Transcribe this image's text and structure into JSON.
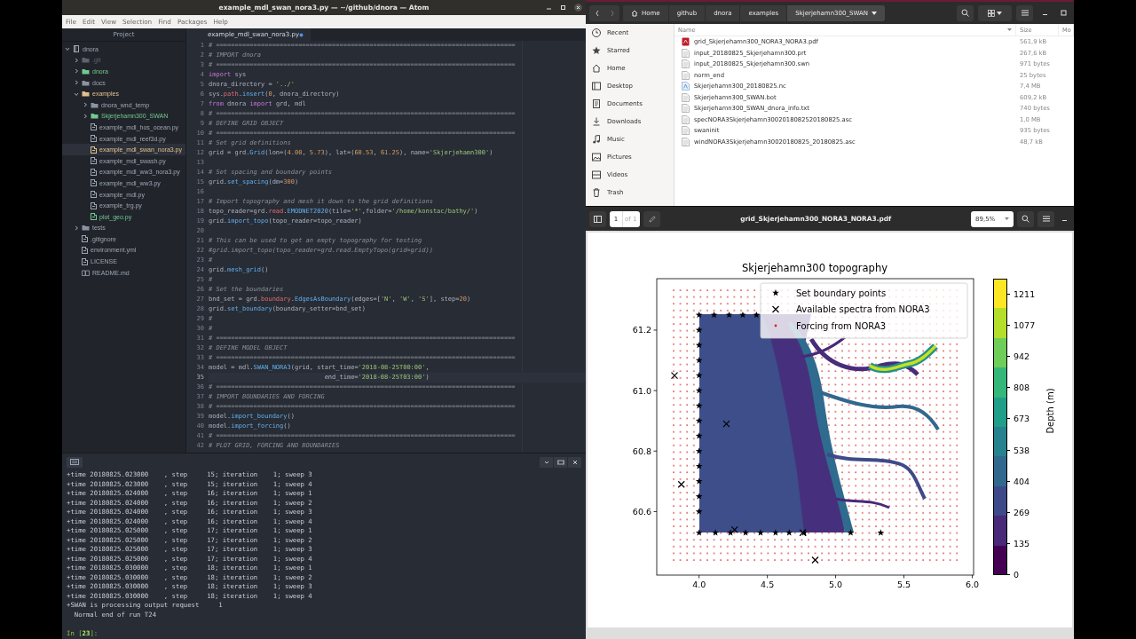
{
  "atom": {
    "title": "example_mdl_swan_nora3.py — ~/github/dnora — Atom",
    "menu": [
      "File",
      "Edit",
      "View",
      "Selection",
      "Find",
      "Packages",
      "Help"
    ],
    "project_title": "Project",
    "tree": [
      {
        "label": "dnora",
        "kind": "repo",
        "expanded": true,
        "selected": false,
        "children": [
          {
            "label": ".git",
            "kind": "folder",
            "expanded": false,
            "selected": false,
            "color": "#5c6370"
          },
          {
            "label": "dnora",
            "kind": "folder",
            "expanded": false,
            "selected": false,
            "color": "#73c990"
          },
          {
            "label": "docs",
            "kind": "folder",
            "expanded": false,
            "selected": false
          },
          {
            "label": "examples",
            "kind": "folder",
            "expanded": true,
            "selected": false,
            "color": "#e2c08d",
            "children": [
              {
                "label": "dnora_wnd_temp",
                "kind": "folder",
                "expanded": false,
                "selected": false
              },
              {
                "label": "Skjerjehamn300_SWAN",
                "kind": "folder",
                "expanded": false,
                "selected": false,
                "color": "#73c990"
              },
              {
                "label": "example_mdl_hos_ocean.py",
                "kind": "file",
                "selected": false
              },
              {
                "label": "example_mdl_reef3d.py",
                "kind": "file",
                "selected": false
              },
              {
                "label": "example_mdl_swan_nora3.py",
                "kind": "file",
                "selected": true,
                "color": "#e2c08d"
              },
              {
                "label": "example_mdl_swash.py",
                "kind": "file",
                "selected": false
              },
              {
                "label": "example_mdl_ww3_nora3.py",
                "kind": "file",
                "selected": false
              },
              {
                "label": "example_mdl_ww3.py",
                "kind": "file",
                "selected": false
              },
              {
                "label": "example_mdl.py",
                "kind": "file",
                "selected": false
              },
              {
                "label": "example_trg.py",
                "kind": "file",
                "selected": false
              },
              {
                "label": "plot_geo.py",
                "kind": "file",
                "selected": false,
                "color": "#73c990"
              }
            ]
          },
          {
            "label": "tests",
            "kind": "folder",
            "expanded": false,
            "selected": false
          },
          {
            "label": ".gitignore",
            "kind": "file",
            "selected": false
          },
          {
            "label": "environment.yml",
            "kind": "file",
            "selected": false
          },
          {
            "label": "LICENSE",
            "kind": "file",
            "selected": false
          },
          {
            "label": "README.md",
            "kind": "markdown",
            "selected": false
          }
        ]
      }
    ],
    "tab": {
      "label": "example_mdl_swan_nora3.py",
      "selected": true,
      "modified": true
    },
    "code": [
      {
        "number": "1",
        "current": false,
        "tokens": [
          {
            "kind": "com",
            "text": "# ================================================================================"
          }
        ]
      },
      {
        "number": "2",
        "current": false,
        "tokens": [
          {
            "kind": "com",
            "text": "# IMPORT dnora"
          }
        ]
      },
      {
        "number": "3",
        "current": false,
        "tokens": [
          {
            "kind": "com",
            "text": "# ================================================================================"
          }
        ]
      },
      {
        "number": "4",
        "current": false,
        "tokens": [
          {
            "kind": "kw",
            "text": "import"
          },
          {
            "kind": "txt",
            "text": " sys"
          }
        ]
      },
      {
        "number": "5",
        "current": false,
        "tokens": [
          {
            "kind": "txt",
            "text": "dnora_directory = "
          },
          {
            "kind": "str",
            "text": "'../'"
          }
        ]
      },
      {
        "number": "6",
        "current": false,
        "tokens": [
          {
            "kind": "txt",
            "text": "sys."
          },
          {
            "kind": "attr",
            "text": "path"
          },
          {
            "kind": "txt",
            "text": "."
          },
          {
            "kind": "fn",
            "text": "insert"
          },
          {
            "kind": "txt",
            "text": "("
          },
          {
            "kind": "num",
            "text": "0"
          },
          {
            "kind": "txt",
            "text": ", dnora_directory)"
          }
        ]
      },
      {
        "number": "7",
        "current": false,
        "tokens": [
          {
            "kind": "kw",
            "text": "from"
          },
          {
            "kind": "txt",
            "text": " dnora "
          },
          {
            "kind": "kw",
            "text": "import"
          },
          {
            "kind": "txt",
            "text": " grd, mdl"
          }
        ]
      },
      {
        "number": "8",
        "current": false,
        "tokens": [
          {
            "kind": "com",
            "text": "# ================================================================================"
          }
        ]
      },
      {
        "number": "9",
        "current": false,
        "tokens": [
          {
            "kind": "com",
            "text": "# DEFINE GRID OBJECT"
          }
        ]
      },
      {
        "number": "10",
        "current": false,
        "tokens": [
          {
            "kind": "com",
            "text": "# ================================================================================"
          }
        ]
      },
      {
        "number": "11",
        "current": false,
        "tokens": [
          {
            "kind": "com",
            "text": "# Set grid definitions"
          }
        ]
      },
      {
        "number": "12",
        "current": false,
        "tokens": [
          {
            "kind": "txt",
            "text": "grid = grd."
          },
          {
            "kind": "fn",
            "text": "Grid"
          },
          {
            "kind": "txt",
            "text": "(lon=("
          },
          {
            "kind": "num",
            "text": "4.00"
          },
          {
            "kind": "txt",
            "text": ", "
          },
          {
            "kind": "num",
            "text": "5.73"
          },
          {
            "kind": "txt",
            "text": "), lat=("
          },
          {
            "kind": "num",
            "text": "60.53"
          },
          {
            "kind": "txt",
            "text": ", "
          },
          {
            "kind": "num",
            "text": "61.25"
          },
          {
            "kind": "txt",
            "text": "), name="
          },
          {
            "kind": "str",
            "text": "'Skjerjehamn300'"
          },
          {
            "kind": "txt",
            "text": ")"
          }
        ]
      },
      {
        "number": "13",
        "current": false
      },
      {
        "number": "14",
        "current": false,
        "tokens": [
          {
            "kind": "com",
            "text": "# Set spacing and boundary points"
          }
        ]
      },
      {
        "number": "15",
        "current": false,
        "tokens": [
          {
            "kind": "txt",
            "text": "grid."
          },
          {
            "kind": "fn",
            "text": "set_spacing"
          },
          {
            "kind": "txt",
            "text": "(dm="
          },
          {
            "kind": "num",
            "text": "300"
          },
          {
            "kind": "txt",
            "text": ")"
          }
        ]
      },
      {
        "number": "16",
        "current": false
      },
      {
        "number": "17",
        "current": false,
        "tokens": [
          {
            "kind": "com",
            "text": "# Import topography and mesh it down to the grid definitions"
          }
        ]
      },
      {
        "number": "18",
        "current": false,
        "tokens": [
          {
            "kind": "txt",
            "text": "topo_reader=grd."
          },
          {
            "kind": "attr",
            "text": "read"
          },
          {
            "kind": "txt",
            "text": "."
          },
          {
            "kind": "fn",
            "text": "EMODNET2020"
          },
          {
            "kind": "txt",
            "text": "(tile="
          },
          {
            "kind": "str",
            "text": "'*'"
          },
          {
            "kind": "txt",
            "text": ",folder="
          },
          {
            "kind": "str",
            "text": "'/home/konstac/bathy/'"
          },
          {
            "kind": "txt",
            "text": ")"
          }
        ]
      },
      {
        "number": "19",
        "current": false,
        "tokens": [
          {
            "kind": "txt",
            "text": "grid."
          },
          {
            "kind": "fn",
            "text": "import_topo"
          },
          {
            "kind": "txt",
            "text": "(topo_reader=topo_reader)"
          }
        ]
      },
      {
        "number": "20",
        "current": false
      },
      {
        "number": "21",
        "current": false,
        "tokens": [
          {
            "kind": "com",
            "text": "# This can be used to get an empty topography for testing"
          }
        ]
      },
      {
        "number": "22",
        "current": false,
        "tokens": [
          {
            "kind": "com",
            "text": "#grid.import_topo(topo_reader=grd.read.EmptyTopo(grid=grid))"
          }
        ]
      },
      {
        "number": "23",
        "current": false,
        "tokens": [
          {
            "kind": "com",
            "text": "#"
          }
        ]
      },
      {
        "number": "24",
        "current": false,
        "tokens": [
          {
            "kind": "txt",
            "text": "grid."
          },
          {
            "kind": "fn",
            "text": "mesh_grid"
          },
          {
            "kind": "txt",
            "text": "()"
          }
        ]
      },
      {
        "number": "25",
        "current": false,
        "tokens": [
          {
            "kind": "com",
            "text": "#"
          }
        ]
      },
      {
        "number": "26",
        "current": false,
        "tokens": [
          {
            "kind": "com",
            "text": "# Set the boundaries"
          }
        ]
      },
      {
        "number": "27",
        "current": false,
        "tokens": [
          {
            "kind": "txt",
            "text": "bnd_set = grd."
          },
          {
            "kind": "attr",
            "text": "boundary"
          },
          {
            "kind": "txt",
            "text": "."
          },
          {
            "kind": "fn",
            "text": "EdgesAsBoundary"
          },
          {
            "kind": "txt",
            "text": "(edges=["
          },
          {
            "kind": "str",
            "text": "'N'"
          },
          {
            "kind": "txt",
            "text": ", "
          },
          {
            "kind": "str",
            "text": "'W'"
          },
          {
            "kind": "txt",
            "text": ", "
          },
          {
            "kind": "str",
            "text": "'S'"
          },
          {
            "kind": "txt",
            "text": "], step="
          },
          {
            "kind": "num",
            "text": "20"
          },
          {
            "kind": "txt",
            "text": ")"
          }
        ]
      },
      {
        "number": "28",
        "current": false,
        "tokens": [
          {
            "kind": "txt",
            "text": "grid."
          },
          {
            "kind": "fn",
            "text": "set_boundary"
          },
          {
            "kind": "txt",
            "text": "(boundary_setter=bnd_set)"
          }
        ]
      },
      {
        "number": "29",
        "current": false,
        "tokens": [
          {
            "kind": "com",
            "text": "#"
          }
        ]
      },
      {
        "number": "30",
        "current": false,
        "tokens": [
          {
            "kind": "com",
            "text": "#"
          }
        ]
      },
      {
        "number": "31",
        "current": false,
        "tokens": [
          {
            "kind": "com",
            "text": "# ================================================================================"
          }
        ]
      },
      {
        "number": "32",
        "current": false,
        "tokens": [
          {
            "kind": "com",
            "text": "# DEFINE MODEL OBJECT"
          }
        ]
      },
      {
        "number": "33",
        "current": false,
        "tokens": [
          {
            "kind": "com",
            "text": "# ================================================================================"
          }
        ]
      },
      {
        "number": "34",
        "current": false,
        "tokens": [
          {
            "kind": "txt",
            "text": "model = mdl."
          },
          {
            "kind": "fn",
            "text": "SWAN_NORA3"
          },
          {
            "kind": "txt",
            "text": "(grid, start_time="
          },
          {
            "kind": "str",
            "text": "'2018-08-25T00:00'"
          },
          {
            "kind": "txt",
            "text": ","
          }
        ]
      },
      {
        "number": "35",
        "current": true,
        "tokens": [
          {
            "kind": "txt",
            "text": "                               end_time="
          },
          {
            "kind": "str",
            "text": "'2018-08-25T03:00'"
          },
          {
            "kind": "txt",
            "text": ")"
          }
        ]
      },
      {
        "number": "36",
        "current": false,
        "tokens": [
          {
            "kind": "com",
            "text": "# ================================================================================"
          }
        ]
      },
      {
        "number": "37",
        "current": false,
        "tokens": [
          {
            "kind": "com",
            "text": "# IMPORT BOUNDARIES AND FORCING"
          }
        ]
      },
      {
        "number": "38",
        "current": false,
        "tokens": [
          {
            "kind": "com",
            "text": "# ================================================================================"
          }
        ]
      },
      {
        "number": "39",
        "current": false,
        "tokens": [
          {
            "kind": "txt",
            "text": "model."
          },
          {
            "kind": "fn",
            "text": "import_boundary"
          },
          {
            "kind": "txt",
            "text": "()"
          }
        ]
      },
      {
        "number": "40",
        "current": false,
        "tokens": [
          {
            "kind": "txt",
            "text": "model."
          },
          {
            "kind": "fn",
            "text": "import_forcing"
          },
          {
            "kind": "txt",
            "text": "()"
          }
        ]
      },
      {
        "number": "41",
        "current": false,
        "tokens": [
          {
            "kind": "com",
            "text": "# ================================================================================"
          }
        ]
      },
      {
        "number": "42",
        "current": false,
        "tokens": [
          {
            "kind": "com",
            "text": "# PLOT GRID, FORCING AND BOUNDARIES"
          }
        ]
      }
    ],
    "terminal": {
      "lines": [
        "+time 20180825.023000    , step     15; iteration    1; sweep 3",
        "+time 20180825.023000    , step     15; iteration    1; sweep 4",
        "+time 20180825.024000    , step     16; iteration    1; sweep 1",
        "+time 20180825.024000    , step     16; iteration    1; sweep 2",
        "+time 20180825.024000    , step     16; iteration    1; sweep 3",
        "+time 20180825.024000    , step     16; iteration    1; sweep 4",
        "+time 20180825.025000    , step     17; iteration    1; sweep 1",
        "+time 20180825.025000    , step     17; iteration    1; sweep 2",
        "+time 20180825.025000    , step     17; iteration    1; sweep 3",
        "+time 20180825.025000    , step     17; iteration    1; sweep 4",
        "+time 20180825.030000    , step     18; iteration    1; sweep 1",
        "+time 20180825.030000    , step     18; iteration    1; sweep 2",
        "+time 20180825.030000    , step     18; iteration    1; sweep 3",
        "+time 20180825.030000    , step     18; iteration    1; sweep 4",
        "+SWAN is processing output request     1",
        "  Normal end of run T24"
      ],
      "prompt": "In [**23**]:"
    }
  },
  "files": {
    "path": [
      {
        "label": "Home",
        "kind": "home",
        "selected": false
      },
      {
        "label": "github",
        "selected": false
      },
      {
        "label": "dnora",
        "selected": false
      },
      {
        "label": "examples",
        "selected": false
      },
      {
        "label": "Skjerjehamn300_SWAN",
        "selected": true
      }
    ],
    "places": [
      {
        "label": "Recent",
        "kind": "recent"
      },
      {
        "label": "Starred",
        "kind": "starred"
      },
      {
        "label": "Home",
        "kind": "home"
      },
      {
        "label": "Desktop",
        "kind": "desktop"
      },
      {
        "label": "Documents",
        "kind": "documents"
      },
      {
        "label": "Downloads",
        "kind": "downloads"
      },
      {
        "label": "Music",
        "kind": "music"
      },
      {
        "label": "Pictures",
        "kind": "pictures"
      },
      {
        "label": "Videos",
        "kind": "videos"
      },
      {
        "label": "Trash",
        "kind": "trash"
      }
    ],
    "columns": [
      {
        "label": "Name",
        "sorted": true
      },
      {
        "label": "Size",
        "sorted": false
      },
      {
        "label": "Mo",
        "sorted": false
      }
    ],
    "rows": [
      {
        "name": "grid_Skjerjehamn300_NORA3_NORA3.pdf",
        "size": "561,9 kB",
        "kind": "pdf"
      },
      {
        "name": "input_20180825_Skjerjehamn300.prt",
        "size": "267,6 kB",
        "kind": "text"
      },
      {
        "name": "input_20180825_Skjerjehamn300.swn",
        "size": "971 bytes",
        "kind": "text"
      },
      {
        "name": "norm_end",
        "size": "25 bytes",
        "kind": "text"
      },
      {
        "name": "Skjerjehamn300_20180825.nc",
        "size": "7,4 MB",
        "kind": "data"
      },
      {
        "name": "Skjerjehamn300_SWAN.bot",
        "size": "609,2 kB",
        "kind": "text"
      },
      {
        "name": "Skjerjehamn300_SWAN_dnora_info.txt",
        "size": "740 bytes",
        "kind": "text"
      },
      {
        "name": "specNORA3Skjerjehamn3002018082520180825.asc",
        "size": "1,0 MB",
        "kind": "text"
      },
      {
        "name": "swaninit",
        "size": "935 bytes",
        "kind": "text"
      },
      {
        "name": "windNORA3Skjerjehamn30020180825_20180825.asc",
        "size": "48,7 kB",
        "kind": "text"
      }
    ]
  },
  "pdf": {
    "page": "1",
    "page_count": "of 1",
    "title": "grid_Skjerjehamn300_NORA3_NORA3.pdf",
    "zoom": "89,5%",
    "chart_data": {
      "type": "scatter",
      "title": "Skjerjehamn300 topography",
      "legend": true,
      "xlim": [
        3.69,
        6.01
      ],
      "ylim": [
        60.39,
        61.37
      ],
      "xticks": [
        {
          "value": 4,
          "label": "4.0"
        },
        {
          "value": 4.5,
          "label": "4.5"
        },
        {
          "value": 5,
          "label": "5.0"
        },
        {
          "value": 5.5,
          "label": "5.5"
        },
        {
          "value": 6,
          "label": "6.0"
        }
      ],
      "yticks": [
        {
          "value": 60.6,
          "label": "60.6"
        },
        {
          "value": 60.8,
          "label": "60.8"
        },
        {
          "value": 61,
          "label": "61.0"
        },
        {
          "value": 61.2,
          "label": "61.2"
        }
      ],
      "series": [
        {
          "name": "Set boundary points",
          "color": "#000000",
          "marker": "star",
          "x": [
            4.0,
            4.11,
            4.22,
            4.32,
            4.42,
            4.0,
            4.0,
            4.0,
            4.0,
            4.0,
            4.0,
            4.0,
            4.0,
            4.0,
            4.0,
            4.0,
            4.0,
            4.0,
            4.0,
            4.12,
            4.23,
            4.34,
            4.45,
            4.56,
            4.66,
            4.77,
            5.11,
            5.33
          ],
          "values": [
            61.25,
            61.25,
            61.25,
            61.25,
            61.25,
            61.2,
            61.15,
            61.1,
            61.05,
            61.0,
            60.95,
            60.9,
            60.85,
            60.8,
            60.75,
            60.7,
            60.65,
            60.6,
            60.53,
            60.53,
            60.53,
            60.53,
            60.53,
            60.53,
            60.53,
            60.53,
            60.53,
            60.53
          ]
        },
        {
          "name": "Available spectra from NORA3",
          "color": "#000000",
          "marker": "cross",
          "x": [
            3.82,
            4.2,
            3.87,
            4.26,
            4.76,
            4.85
          ],
          "values": [
            61.05,
            60.89,
            60.69,
            60.54,
            60.53,
            60.44
          ]
        }
      ]
    },
    "forcing_legend": {
      "label": "Forcing from NORA3",
      "color": "#d62728"
    },
    "colorbar": {
      "label": "Depth (m)",
      "ticks": [
        "1211",
        "1077",
        "942",
        "808",
        "673",
        "538",
        "404",
        "269",
        "135",
        "0"
      ]
    }
  }
}
